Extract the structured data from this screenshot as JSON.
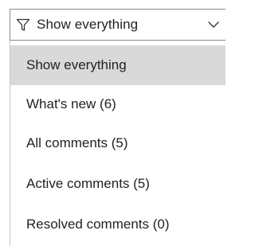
{
  "filter": {
    "label": "Show everything",
    "icon": "filter-icon",
    "dropdown_icon": "chevron-down-icon"
  },
  "menu": {
    "selected_index": 0,
    "items": [
      {
        "label": "Show everything"
      },
      {
        "label": "What's new (6)"
      },
      {
        "label": "All comments (5)"
      },
      {
        "label": "Active comments (5)"
      },
      {
        "label": "Resolved comments (0)"
      }
    ]
  },
  "colors": {
    "selected_background": "#d9d9d9",
    "text": "#222222",
    "border": "#8a8a8a"
  }
}
